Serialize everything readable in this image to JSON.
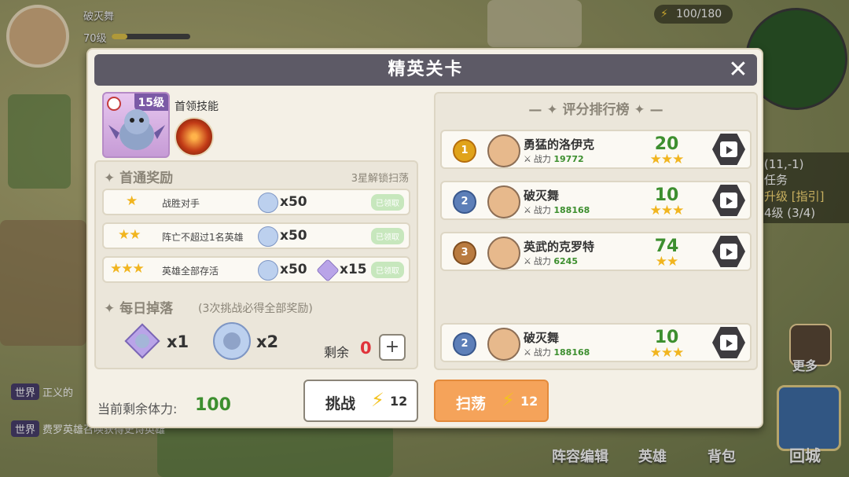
{
  "hud": {
    "player_name": "破灭舞",
    "player_level": "70级",
    "energy": "100/180",
    "chat_channel": "世界",
    "chat_line_1": "正义的",
    "chat_line_2": "费罗英雄召唤获得史诗英雄",
    "side_quest_1": "(11,-1)",
    "side_quest_2": "任务",
    "side_quest_3": "升级 [指引]",
    "side_quest_4": "4级 (3/4)",
    "more_label": "更多",
    "btn_formation": "阵容编辑",
    "btn_heroes": "英雄",
    "btn_bag": "背包",
    "btn_city": "回城"
  },
  "modal": {
    "title": "精英关卡",
    "close_icon": "close-icon",
    "boss": {
      "level": "15级",
      "skill_label": "首领技能"
    },
    "first_clear": {
      "title": "首通奖励",
      "subtitle": "3星解锁扫荡",
      "rows": [
        {
          "stars": "★",
          "label": "战胜对手",
          "qty": "x50",
          "status": "已领取"
        },
        {
          "stars": "★★",
          "label": "阵亡不超过1名英雄",
          "qty": "x50",
          "status": "已领取"
        },
        {
          "stars": "★★★",
          "label": "英雄全部存活",
          "qty": "x50",
          "qty2": "x15",
          "status": "已领取"
        }
      ]
    },
    "daily": {
      "title": "每日掉落",
      "subtitle": "(3次挑战必得全部奖励)",
      "item1_qty": "x1",
      "item2_qty": "x2",
      "remain_label": "剩余",
      "remain_value": "0",
      "plus": "+"
    },
    "stamina_label": "当前剩余体力:",
    "stamina_value": "100",
    "challenge_label": "挑战",
    "challenge_cost": "12",
    "sweep_label": "扫荡",
    "sweep_cost": "12",
    "ranking": {
      "title": "评分排行榜",
      "power_label": "战力",
      "rows": [
        {
          "rank": "1",
          "name": "勇猛的洛伊克",
          "power": "19772",
          "score": "20",
          "stars": "★★★"
        },
        {
          "rank": "2",
          "name": "破灭舞",
          "power": "188168",
          "score": "10",
          "stars": "★★★"
        },
        {
          "rank": "3",
          "name": "英武的克罗特",
          "power": "6245",
          "score": "74",
          "stars": "★★"
        }
      ],
      "self": {
        "rank": "2",
        "name": "破灭舞",
        "power": "188168",
        "score": "10",
        "stars": "★★★"
      }
    }
  }
}
